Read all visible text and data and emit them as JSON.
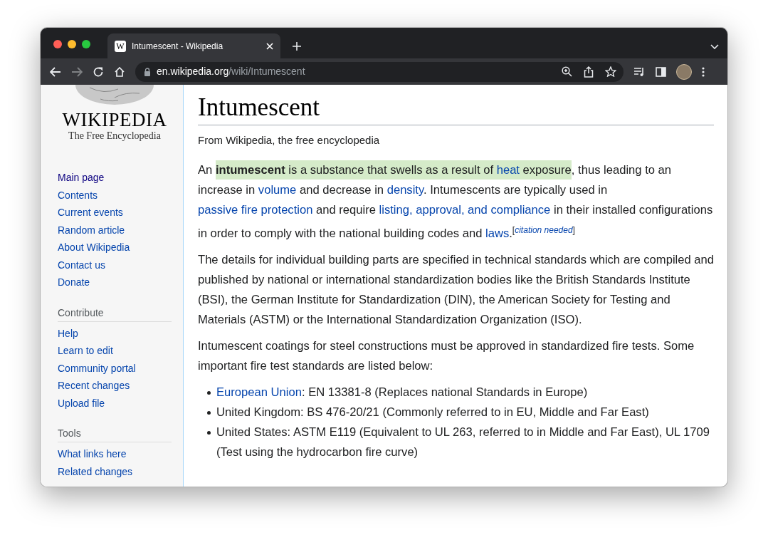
{
  "tab": {
    "title": "Intumescent - Wikipedia",
    "favicon": "W",
    "selected": true
  },
  "toolbar": {
    "forward_disabled": true,
    "address": {
      "host": "en.wikipedia.org",
      "path": "/wiki/Intumescent"
    }
  },
  "sidebar": {
    "logo": {
      "wordmark": "WIKIPEDIA",
      "tagline": "The Free Encyclopedia"
    },
    "sections": [
      {
        "items": [
          {
            "label": "Main page",
            "visited": true
          },
          {
            "label": "Contents",
            "visited": false
          },
          {
            "label": "Current events",
            "visited": false
          },
          {
            "label": "Random article",
            "visited": false
          },
          {
            "label": "About Wikipedia",
            "visited": false
          },
          {
            "label": "Contact us",
            "visited": false
          },
          {
            "label": "Donate",
            "visited": false
          }
        ]
      },
      {
        "heading": "Contribute",
        "items": [
          {
            "label": "Help",
            "visited": false
          },
          {
            "label": "Learn to edit",
            "visited": false
          },
          {
            "label": "Community portal",
            "visited": false
          },
          {
            "label": "Recent changes",
            "visited": false
          },
          {
            "label": "Upload file",
            "visited": false
          }
        ]
      },
      {
        "heading": "Tools",
        "items": [
          {
            "label": "What links here",
            "visited": false
          },
          {
            "label": "Related changes",
            "visited": false
          }
        ]
      }
    ]
  },
  "article": {
    "title": "Intumescent",
    "tagline": "From Wikipedia, the free encyclopedia",
    "blocks": [
      {
        "kind": "paragraph",
        "segments": [
          {
            "text": "An ",
            "kind": "text",
            "highlighted": false
          },
          {
            "text": "intumescent",
            "kind": "bold",
            "highlighted": true
          },
          {
            "text": " is a substance that swells as a result of ",
            "kind": "text",
            "highlighted": true
          },
          {
            "text": "heat",
            "kind": "link",
            "highlighted": true
          },
          {
            "text": " exposure",
            "kind": "text",
            "highlighted": true
          },
          {
            "text": ", thus leading to an increase in ",
            "kind": "text",
            "highlighted": false
          },
          {
            "text": "volume",
            "kind": "link",
            "highlighted": false
          },
          {
            "text": " and decrease in ",
            "kind": "text",
            "highlighted": false
          },
          {
            "text": "density",
            "kind": "link",
            "highlighted": false
          },
          {
            "text": ". Intumescents are typically used in ",
            "kind": "text",
            "highlighted": false
          },
          {
            "text": "passive fire protection",
            "kind": "link",
            "highlighted": false
          },
          {
            "text": " and require ",
            "kind": "text",
            "highlighted": false
          },
          {
            "text": "listing, approval, and compliance",
            "kind": "link",
            "highlighted": false
          },
          {
            "text": " in their installed configurations in order to comply with the national building codes and ",
            "kind": "text",
            "highlighted": false
          },
          {
            "text": "laws",
            "kind": "link",
            "highlighted": false
          },
          {
            "text": ".",
            "kind": "text",
            "highlighted": false
          },
          {
            "text": "[",
            "kind": "sup",
            "highlighted": false
          },
          {
            "text": "citation needed",
            "kind": "sup-link",
            "highlighted": false
          },
          {
            "text": "]",
            "kind": "sup",
            "highlighted": false
          }
        ]
      },
      {
        "kind": "paragraph",
        "segments": [
          {
            "text": "The details for individual building parts are specified in technical standards which are compiled and published by national or international standardization bodies like the British Standards Institute (BSI), the German Institute for Standardization (DIN), the American Society for Testing and Materials (ASTM) or the International Standardization Organization (ISO).",
            "kind": "text",
            "highlighted": false
          }
        ]
      },
      {
        "kind": "paragraph",
        "segments": [
          {
            "text": "Intumescent coatings for steel constructions must be approved in standardized fire tests. Some important fire test standards are listed below:",
            "kind": "text",
            "highlighted": false
          }
        ]
      },
      {
        "kind": "list",
        "items": [
          {
            "segments": [
              {
                "text": "European Union",
                "kind": "link",
                "highlighted": false
              },
              {
                "text": ": EN 13381-8 (Replaces national Standards in Europe)",
                "kind": "text",
                "highlighted": false
              }
            ]
          },
          {
            "segments": [
              {
                "text": "United Kingdom: BS 476-20/21 (Commonly referred to in EU, Middle and Far East)",
                "kind": "text",
                "highlighted": false
              }
            ]
          },
          {
            "segments": [
              {
                "text": "United States: ASTM E119 (Equivalent to UL 263, referred to in Middle and Far East), UL 1709 (Test using the hydrocarbon fire curve)",
                "kind": "text",
                "highlighted": false
              }
            ]
          }
        ]
      }
    ]
  }
}
